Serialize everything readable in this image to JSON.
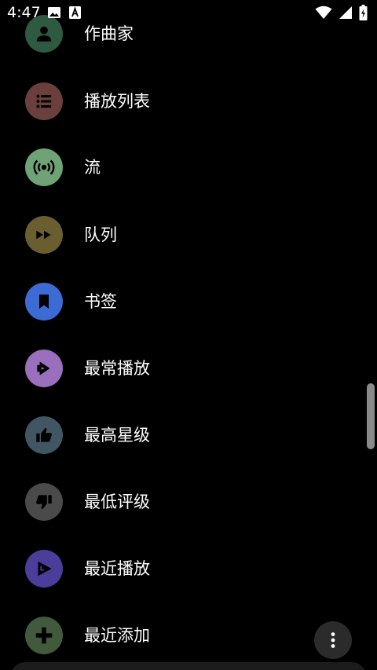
{
  "status_bar": {
    "time": "4:47",
    "left_icons": [
      "image-icon",
      "font-download-icon"
    ],
    "right_icons": [
      "wifi-icon",
      "signal-icon",
      "battery-charging-icon"
    ]
  },
  "list": {
    "items": [
      {
        "label": "作曲家",
        "icon": "composer-person-icon",
        "icon_bg": "#2e5a42"
      },
      {
        "label": "播放列表",
        "icon": "playlist-icon",
        "icon_bg": "#6b3f3b"
      },
      {
        "label": "流",
        "icon": "stream-icon",
        "icon_bg": "#6fa274"
      },
      {
        "label": "队列",
        "icon": "queue-fast-forward-icon",
        "icon_bg": "#6a5e30"
      },
      {
        "label": "书签",
        "icon": "bookmark-icon",
        "icon_bg": "#3d6bd6"
      },
      {
        "label": "最常播放",
        "icon": "most-played-icon",
        "icon_bg": "#9a6fbd"
      },
      {
        "label": "最高星级",
        "icon": "thumb-up-icon",
        "icon_bg": "#405662"
      },
      {
        "label": "最低评级",
        "icon": "thumb-down-icon",
        "icon_bg": "#4a4a4a"
      },
      {
        "label": "最近播放",
        "icon": "recently-played-icon",
        "icon_bg": "#4a3e9a"
      },
      {
        "label": "最近添加",
        "icon": "add-icon",
        "icon_bg": "#415a3c"
      }
    ]
  },
  "fab": {
    "icon": "more-vertical-icon"
  }
}
